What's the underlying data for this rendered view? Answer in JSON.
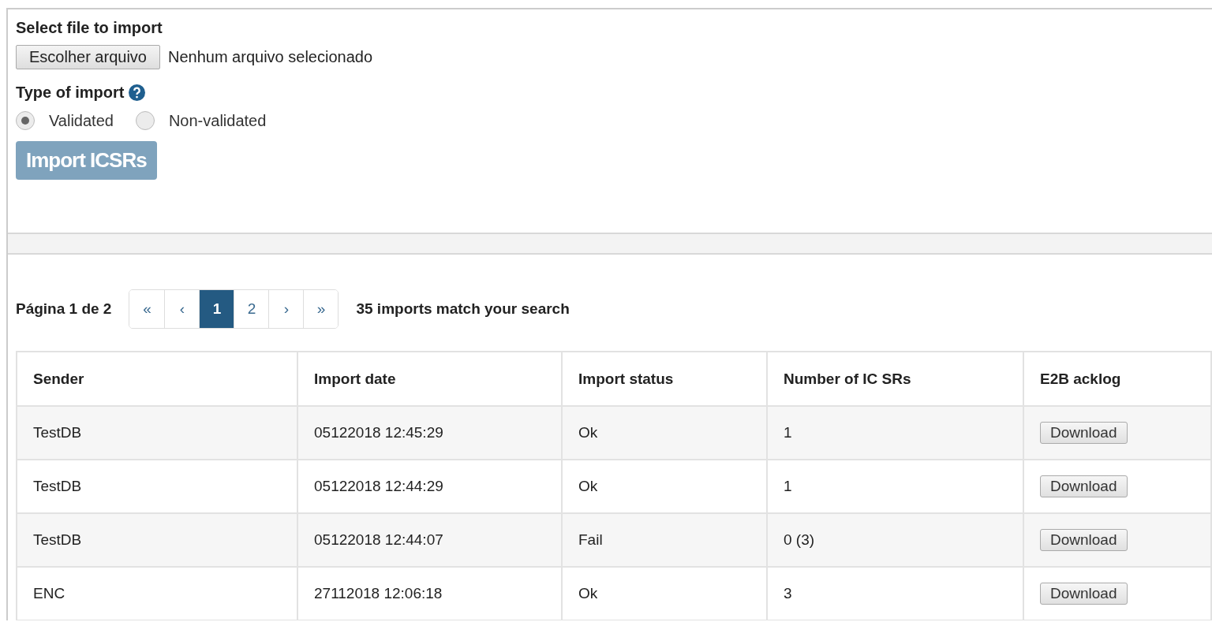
{
  "file_select": {
    "label": "Select file to import",
    "button": "Escolher arquivo",
    "status": "Nenhum arquivo selecionado"
  },
  "import_type": {
    "label": "Type of import",
    "options": [
      {
        "label": "Validated",
        "selected": true
      },
      {
        "label": "Non-validated",
        "selected": false
      }
    ]
  },
  "import_button": {
    "label": "Import ICSRs",
    "disabled": true
  },
  "pagination": {
    "page_info": "Página 1 de 2",
    "pages": [
      {
        "label": "«",
        "selected": false
      },
      {
        "label": "‹",
        "selected": false
      },
      {
        "label": "1",
        "selected": true
      },
      {
        "label": "2",
        "selected": false
      },
      {
        "label": "›",
        "selected": false
      },
      {
        "label": "»",
        "selected": false
      }
    ],
    "summary": "35 imports match your search"
  },
  "table": {
    "columns": [
      "Sender",
      "Import date",
      "Import status",
      "Number of IC SRs",
      "E2B acklog"
    ],
    "rows": [
      {
        "sender": "TestDB",
        "date": "05122018 12:45:29",
        "status": "Ok",
        "count": "1",
        "action": "Download"
      },
      {
        "sender": "TestDB",
        "date": "05122018 12:44:29",
        "status": "Ok",
        "count": "1",
        "action": "Download"
      },
      {
        "sender": "TestDB",
        "date": "05122018 12:44:07",
        "status": "Fail",
        "count": "0 (3)",
        "action": "Download"
      },
      {
        "sender": "ENC",
        "date": "27112018 12:06:18",
        "status": "Ok",
        "count": "3",
        "action": "Download"
      }
    ]
  }
}
